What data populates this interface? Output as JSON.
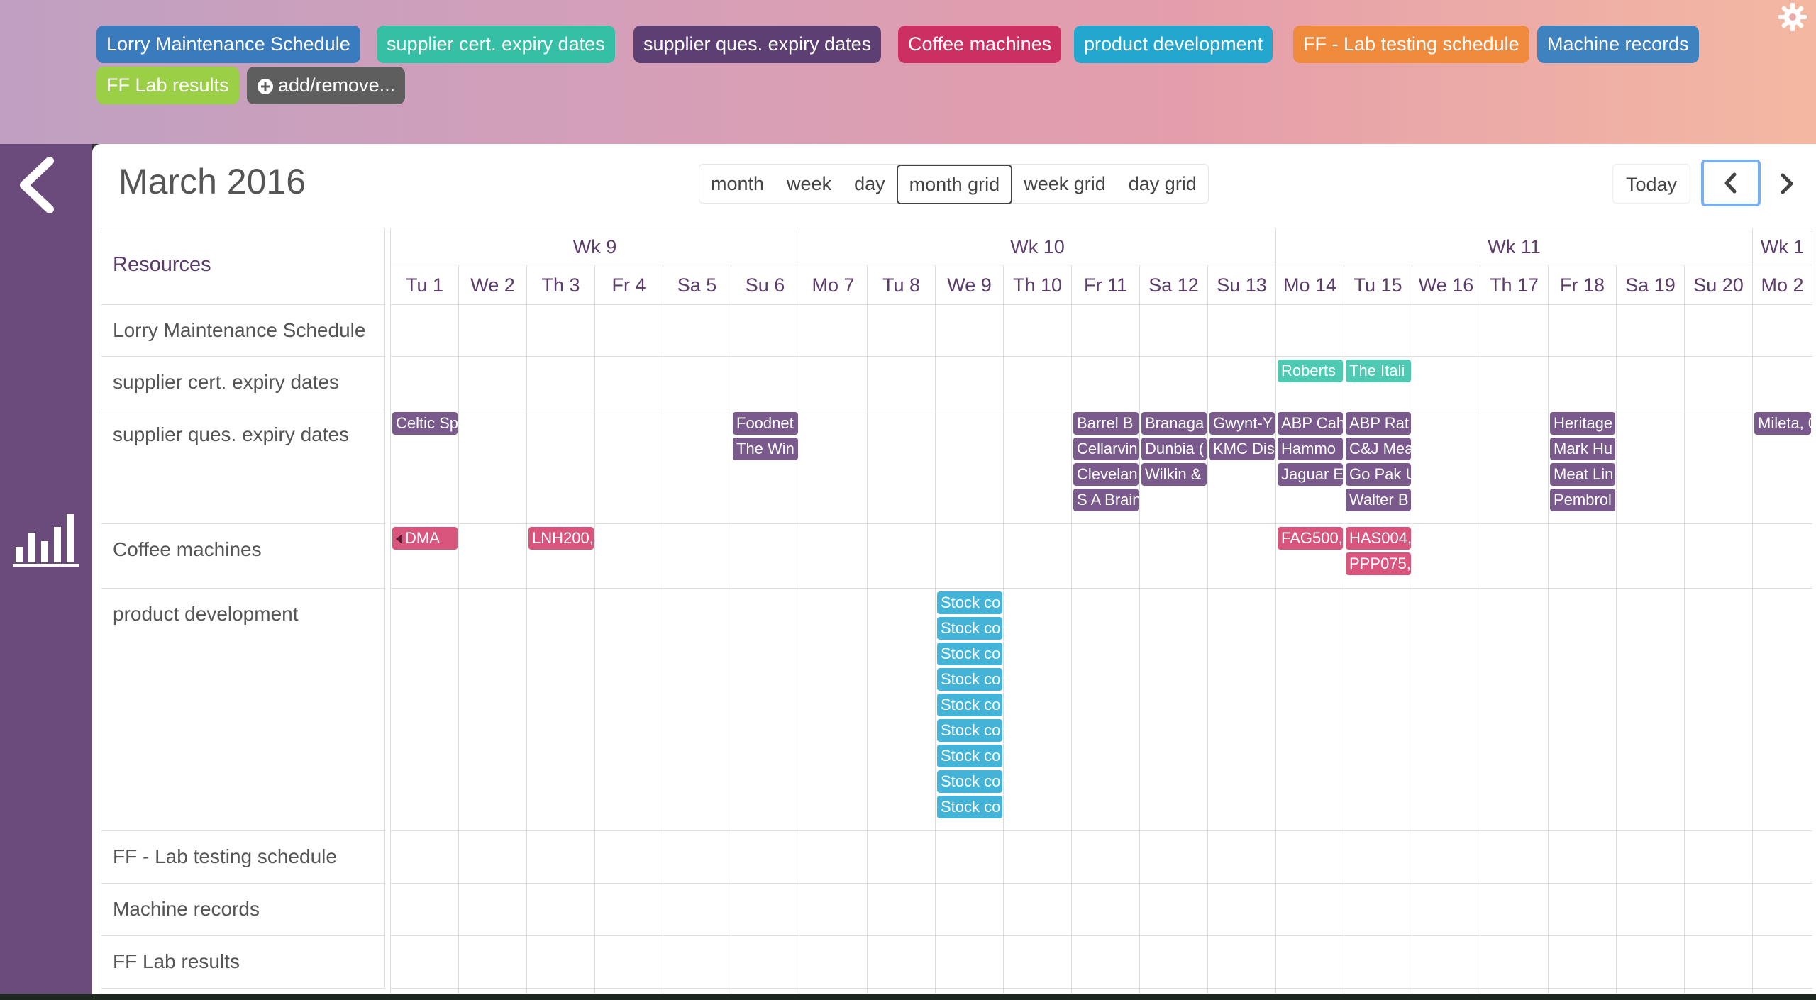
{
  "colors": {
    "lorry": "#3a7bbd",
    "supplier_cert": "#35bfa5",
    "supplier_ques": "#5e3f73",
    "coffee": "#cc2f61",
    "product_dev": "#23a7cf",
    "ff_lab_testing": "#f08a3c",
    "machine_records": "#3f82c0",
    "ff_lab_results": "#9bcf46",
    "add_remove": "#5e5e5e",
    "event_cert": "#4fcab2",
    "event_ques": "#7a5a8c",
    "event_coffee": "#d9557e",
    "event_product": "#43b3d8"
  },
  "calendar_filters": [
    "Lorry Maintenance Schedule",
    "supplier cert. expiry dates",
    "supplier ques. expiry dates",
    "Coffee machines",
    "product development",
    "FF - Lab testing schedule",
    "Machine records",
    "FF Lab results"
  ],
  "add_remove_label": "add/remove...",
  "toolbar": {
    "title": "March 2016",
    "views": [
      "month",
      "week",
      "day",
      "month grid",
      "week grid",
      "day grid"
    ],
    "active_view": "month grid",
    "today_label": "Today"
  },
  "grid": {
    "resources_header": "Resources",
    "weeks": [
      "Wk 9",
      "Wk 10",
      "Wk 11",
      "Wk 1"
    ],
    "days": [
      "Tu 1",
      "We 2",
      "Th 3",
      "Fr 4",
      "Sa 5",
      "Su 6",
      "Mo 7",
      "Tu 8",
      "We 9",
      "Th 10",
      "Fr 11",
      "Sa 12",
      "Su 13",
      "Mo 14",
      "Tu 15",
      "We 16",
      "Th 17",
      "Fr 18",
      "Sa 19",
      "Su 20",
      "Mo 2"
    ],
    "resources": [
      "Lorry Maintenance Schedule",
      "supplier cert. expiry dates",
      "supplier ques. expiry dates",
      "Coffee machines",
      "product development",
      "FF - Lab testing schedule",
      "Machine records",
      "FF Lab results"
    ]
  },
  "events": {
    "supplier_cert": [
      {
        "day": "Mo 14",
        "text": "Roberts"
      },
      {
        "day": "Tu 15",
        "text": "The Itali"
      }
    ],
    "supplier_ques": [
      {
        "day": "Tu 1",
        "text": "Celtic Sp"
      },
      {
        "day": "Su 6",
        "text": "Foodnet"
      },
      {
        "day": "Su 6",
        "text": "The Win"
      },
      {
        "day": "Fr 11",
        "text": "Barrel B"
      },
      {
        "day": "Fr 11",
        "text": "Cellarvin"
      },
      {
        "day": "Fr 11",
        "text": "Clevelan"
      },
      {
        "day": "Fr 11",
        "text": "S A Brain"
      },
      {
        "day": "Sa 12",
        "text": "Branaga"
      },
      {
        "day": "Sa 12",
        "text": "Dunbia ("
      },
      {
        "day": "Sa 12",
        "text": "Wilkin &"
      },
      {
        "day": "Su 13",
        "text": "Gwynt-Y"
      },
      {
        "day": "Su 13",
        "text": "KMC Dis"
      },
      {
        "day": "Mo 14",
        "text": "ABP Cah"
      },
      {
        "day": "Mo 14",
        "text": "Hammo"
      },
      {
        "day": "Mo 14",
        "text": "Jaguar E"
      },
      {
        "day": "Tu 15",
        "text": "ABP Rat"
      },
      {
        "day": "Tu 15",
        "text": "C&J Mea"
      },
      {
        "day": "Tu 15",
        "text": "Go Pak U"
      },
      {
        "day": "Tu 15",
        "text": "Walter B"
      },
      {
        "day": "Fr 18",
        "text": "Heritage"
      },
      {
        "day": "Fr 18",
        "text": "Mark Hu"
      },
      {
        "day": "Fr 18",
        "text": "Meat Lin"
      },
      {
        "day": "Fr 18",
        "text": "Pembrol"
      },
      {
        "day": "Mo 2",
        "text": "Mileta, 0"
      }
    ],
    "coffee": [
      {
        "day": "Tu 1",
        "text": "DMA"
      },
      {
        "day": "Th 3",
        "text": "LNH200,"
      },
      {
        "day": "Mo 14",
        "text": "FAG500,"
      },
      {
        "day": "Tu 15",
        "text": "HAS004,"
      },
      {
        "day": "Tu 15",
        "text": "PPP075,"
      }
    ],
    "product_dev": [
      {
        "day": "We 9",
        "text": "Stock co"
      },
      {
        "day": "We 9",
        "text": "Stock co"
      },
      {
        "day": "We 9",
        "text": "Stock co"
      },
      {
        "day": "We 9",
        "text": "Stock co"
      },
      {
        "day": "We 9",
        "text": "Stock co"
      },
      {
        "day": "We 9",
        "text": "Stock co"
      },
      {
        "day": "We 9",
        "text": "Stock co"
      },
      {
        "day": "We 9",
        "text": "Stock co"
      },
      {
        "day": "We 9",
        "text": "Stock co"
      }
    ]
  }
}
